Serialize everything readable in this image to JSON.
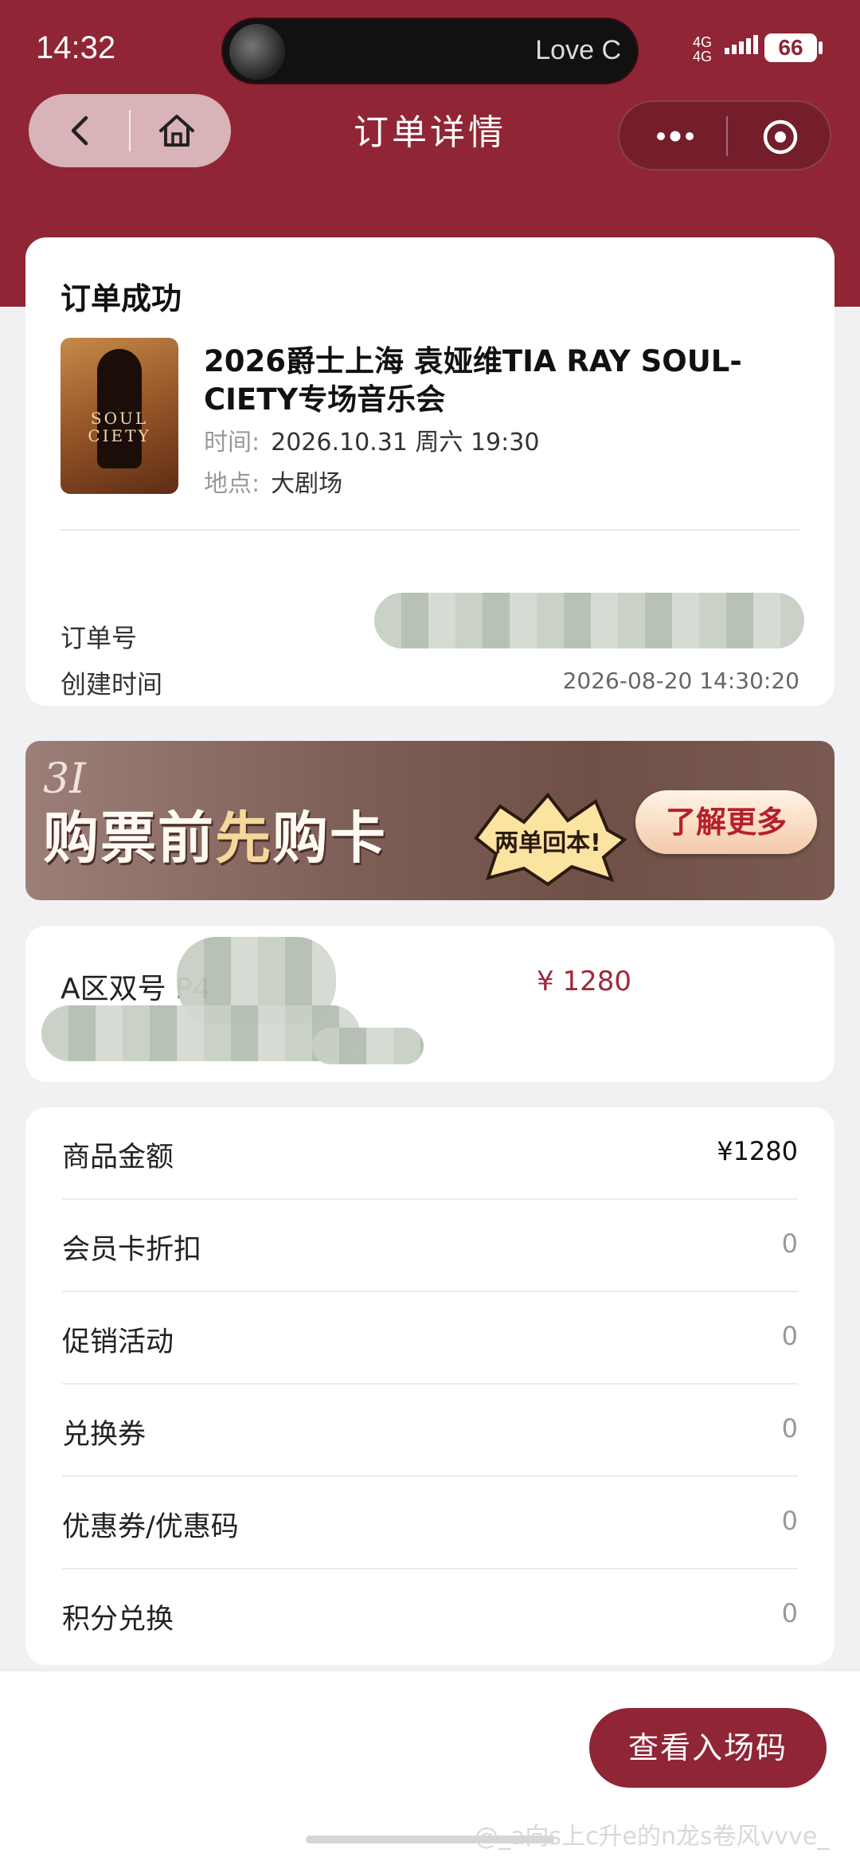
{
  "status_bar": {
    "time": "14:32",
    "now_playing": "Love C",
    "network": "4G",
    "battery": "66"
  },
  "nav": {
    "title": "订单详情"
  },
  "order": {
    "status": "订单成功",
    "event_title": "2026爵士上海 袁娅维TIA RAY SOUL-CIETY专场音乐会",
    "time_label": "时间:",
    "time_value": "2026.10.31 周六 19:30",
    "venue_label": "地点:",
    "venue_value": "大剧场",
    "order_no_label": "订单号",
    "created_label": "创建时间",
    "created_value": "2026-08-20 14:30:20",
    "poster_text": "SOUL CIETY"
  },
  "banner": {
    "logo": "3I",
    "text_before": "购票前",
    "text_highlight": "先",
    "text_after": "购卡",
    "sticker": "两单回本!",
    "button": "了解更多"
  },
  "seat": {
    "label": "A区双号  P4",
    "price": "¥ 1280"
  },
  "prices": [
    {
      "label": "商品金额",
      "value": "¥1280"
    },
    {
      "label": "会员卡折扣",
      "value": "0"
    },
    {
      "label": "促销活动",
      "value": "0"
    },
    {
      "label": "兑换券",
      "value": "0"
    },
    {
      "label": "优惠券/优惠码",
      "value": "0"
    },
    {
      "label": "积分兑换",
      "value": "0"
    }
  ],
  "cta": {
    "label": "查看入场码"
  },
  "watermark": "@_a向s上c升e的n龙s卷风vvve_"
}
